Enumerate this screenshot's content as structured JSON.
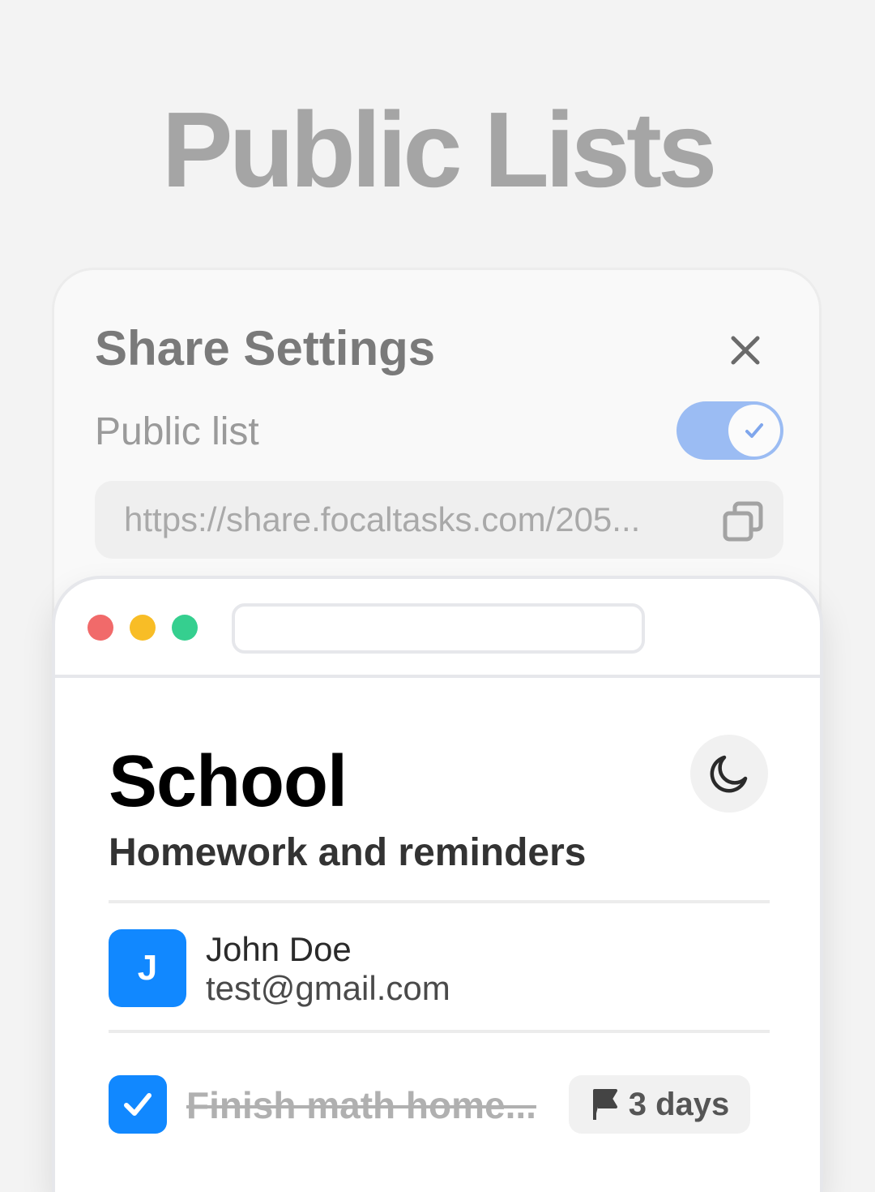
{
  "hero": {
    "title": "Public Lists"
  },
  "share_settings": {
    "title": "Share Settings",
    "close_icon": "close-icon",
    "public_label": "Public list",
    "public_enabled": true,
    "url": "https://share.focaltasks.com/205...",
    "copy_icon": "copy-icon",
    "colors": {
      "toggle_on": "#9bbcf3"
    }
  },
  "browser": {
    "window_dots": [
      "#f16a6a",
      "#f8bd26",
      "#35cf8f"
    ],
    "address": ""
  },
  "list": {
    "title": "School",
    "subtitle": "Homework and reminders",
    "theme_icon": "moon-icon",
    "owner": {
      "initial": "J",
      "name": "John Doe",
      "email": "test@gmail.com",
      "avatar_color": "#1188ff"
    },
    "tasks": [
      {
        "text": "Finish math home...",
        "completed": true,
        "due_icon": "flag-icon",
        "due_label": "3 days"
      }
    ]
  }
}
